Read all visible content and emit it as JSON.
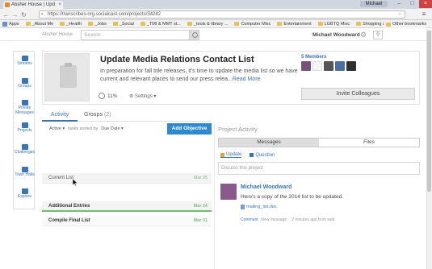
{
  "browser": {
    "tab_title": "Absher House | Upd",
    "user_chip": "Michael",
    "url": "https://transcribes-org.socialcast.com/projects/34242",
    "bookmarks": [
      "Apps",
      "_About Me",
      "_Health",
      "_Jobs",
      "_Social",
      "_TMI & MMT st...",
      "_tools & library ...",
      "Computer Misc",
      "Entertainment",
      "LGBTQ Misc",
      "Shopping & Su..."
    ],
    "other_bookmarks": "Other bookmarks"
  },
  "header": {
    "logo": "Absher House",
    "search_placeholder": "Search",
    "user_name": "Michael Woodward",
    "notifications": "0"
  },
  "rail": {
    "items": [
      "Streams",
      "Groups",
      "Private Messages",
      "Projects",
      "Challenges",
      "Town Halls",
      "Explore"
    ]
  },
  "project": {
    "title": "Update Media Relations Contact List",
    "description": "In preparation for fall title releases, it's time to update the media list so we have current and relevant places to send our press relea...",
    "read_more": "Read More",
    "progress": "11%",
    "settings": "Settings",
    "members_count": "5",
    "members_label": "Members",
    "invite": "Invite Colleagues"
  },
  "tabs": {
    "activity": "Activity",
    "groups": "Groups",
    "groups_count": "(2)"
  },
  "tasks": {
    "filter": "Active",
    "sorted_by": "tasks sorted by",
    "sort": "Due Date",
    "add_objective": "Add Objective",
    "items": [
      {
        "name": "Current List",
        "date": "Mar 25"
      },
      {
        "name": "Additional Entries",
        "date": "Mar 24"
      },
      {
        "name": "Compile Final List",
        "date": "Mar 31"
      }
    ]
  },
  "activity": {
    "title": "Project Activity",
    "tab_messages": "Messages",
    "tab_files": "Files",
    "opt_update": "Update",
    "opt_question": "Question",
    "discuss_placeholder": "Discuss this project",
    "post": {
      "author": "Michael Woodward",
      "text": "Here's a copy of the 2014 list to be updated.",
      "file": "mailing_list.doc",
      "comment": "Comment",
      "view": "View message",
      "meta": "· 2 minutes ago from web"
    }
  },
  "colors": {
    "accent": "#3a73b7",
    "button": "#2d8ad1",
    "due": "#7bbf7b"
  }
}
